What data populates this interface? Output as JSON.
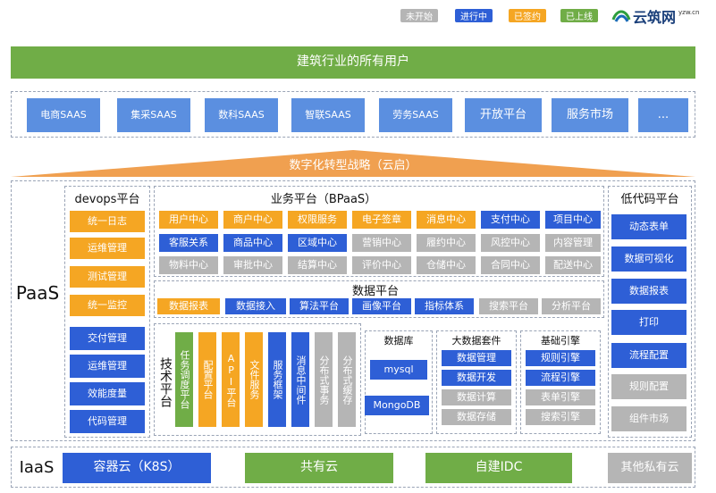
{
  "legend": [
    {
      "label": "未开始",
      "color": "#b5b5b5"
    },
    {
      "label": "进行中",
      "color": "#2e5fd6"
    },
    {
      "label": "已签约",
      "color": "#f5a623"
    },
    {
      "label": "已上线",
      "color": "#70ad47"
    }
  ],
  "logo": {
    "text": "云筑网",
    "small": "yzw.cn"
  },
  "banner_users": "建筑行业的所有用户",
  "saas_items": [
    "电商SAAS",
    "集采SAAS",
    "数科SAAS",
    "智联SAAS",
    "劳务SAAS",
    "开放平台",
    "服务市场",
    "..."
  ],
  "digital_strategy": "数字化转型战略（云启）",
  "paas_label": "PaaS",
  "iaas_label": "IaaS",
  "devops": {
    "title": "devops平台",
    "items": [
      {
        "label": "统一日志",
        "status": "orange"
      },
      {
        "label": "运维管理",
        "status": "orange"
      },
      {
        "label": "测试管理",
        "status": "orange"
      },
      {
        "label": "统一监控",
        "status": "orange"
      },
      {
        "label": "交付管理",
        "status": "blue"
      },
      {
        "label": "运维管理",
        "status": "blue"
      },
      {
        "label": "效能度量",
        "status": "blue"
      },
      {
        "label": "代码管理",
        "status": "blue"
      }
    ]
  },
  "bpaas": {
    "title": "业务平台（BPaaS）",
    "rows": [
      [
        {
          "label": "用户中心",
          "s": "orange"
        },
        {
          "label": "商户中心",
          "s": "orange"
        },
        {
          "label": "权限服务",
          "s": "orange"
        },
        {
          "label": "电子签章",
          "s": "orange"
        },
        {
          "label": "消息中心",
          "s": "orange"
        },
        {
          "label": "支付中心",
          "s": "blue"
        },
        {
          "label": "项目中心",
          "s": "blue"
        }
      ],
      [
        {
          "label": "客服关系",
          "s": "blue"
        },
        {
          "label": "商品中心",
          "s": "blue"
        },
        {
          "label": "区域中心",
          "s": "blue"
        },
        {
          "label": "营销中心",
          "s": "gray"
        },
        {
          "label": "履约中心",
          "s": "gray"
        },
        {
          "label": "风控中心",
          "s": "gray"
        },
        {
          "label": "内容管理",
          "s": "gray"
        }
      ],
      [
        {
          "label": "物料中心",
          "s": "gray"
        },
        {
          "label": "审批中心",
          "s": "gray"
        },
        {
          "label": "结算中心",
          "s": "gray"
        },
        {
          "label": "评价中心",
          "s": "gray"
        },
        {
          "label": "仓储中心",
          "s": "gray"
        },
        {
          "label": "合同中心",
          "s": "gray"
        },
        {
          "label": "配送中心",
          "s": "gray"
        }
      ]
    ]
  },
  "data_platform": {
    "title": "数据平台",
    "items": [
      {
        "label": "数据报表",
        "s": "orange"
      },
      {
        "label": "数据接入",
        "s": "blue"
      },
      {
        "label": "算法平台",
        "s": "blue"
      },
      {
        "label": "画像平台",
        "s": "blue"
      },
      {
        "label": "指标体系",
        "s": "blue"
      },
      {
        "label": "搜索平台",
        "s": "gray"
      },
      {
        "label": "分析平台",
        "s": "gray"
      }
    ]
  },
  "tech_platform": {
    "title": "技术平台",
    "items": [
      {
        "label": "任务调度平台",
        "s": "green"
      },
      {
        "label": "配置平台",
        "s": "orange"
      },
      {
        "label": "API平台",
        "s": "orange"
      },
      {
        "label": "文件服务",
        "s": "orange"
      },
      {
        "label": "服务框架",
        "s": "blue"
      },
      {
        "label": "消息中间件",
        "s": "blue"
      },
      {
        "label": "分布式事务",
        "s": "gray"
      },
      {
        "label": "分布式缓存",
        "s": "gray"
      }
    ]
  },
  "database": {
    "title": "数据库",
    "items": [
      "mysql",
      "MongoDB"
    ]
  },
  "bigdata": {
    "title": "大数据套件",
    "items": [
      {
        "label": "数据管理",
        "s": "blue"
      },
      {
        "label": "数据开发",
        "s": "blue"
      },
      {
        "label": "数据计算",
        "s": "gray"
      },
      {
        "label": "数据存储",
        "s": "gray"
      }
    ]
  },
  "engine": {
    "title": "基础引擎",
    "items": [
      {
        "label": "规则引擎",
        "s": "blue"
      },
      {
        "label": "流程引擎",
        "s": "blue"
      },
      {
        "label": "表单引擎",
        "s": "gray"
      },
      {
        "label": "搜索引擎",
        "s": "gray"
      }
    ]
  },
  "lowcode": {
    "title": "低代码平台",
    "items": [
      {
        "label": "动态表单",
        "s": "blue"
      },
      {
        "label": "数据可视化",
        "s": "blue"
      },
      {
        "label": "数据报表",
        "s": "blue"
      },
      {
        "label": "打印",
        "s": "blue"
      },
      {
        "label": "流程配置",
        "s": "blue"
      },
      {
        "label": "规则配置",
        "s": "gray"
      },
      {
        "label": "组件市场",
        "s": "gray"
      }
    ]
  },
  "iaas_items": [
    {
      "label": "容器云（K8S）",
      "s": "blue"
    },
    {
      "label": "共有云",
      "s": "green"
    },
    {
      "label": "自建IDC",
      "s": "green"
    },
    {
      "label": "其他私有云",
      "s": "gray"
    }
  ]
}
